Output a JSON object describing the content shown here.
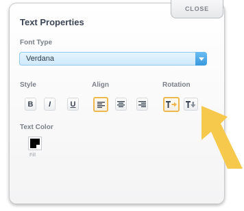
{
  "panel": {
    "title": "Text Properties",
    "close_label": "CLOSE"
  },
  "font": {
    "label": "Font Type",
    "value": "Verdana",
    "arrow_icon": "chevron-down-icon"
  },
  "style": {
    "label": "Style",
    "bold": "B",
    "italic": "I",
    "underline": "U"
  },
  "align": {
    "label": "Align",
    "selected": "left",
    "options": [
      "left",
      "center",
      "right"
    ]
  },
  "rotation": {
    "label": "Rotation",
    "selected": "horizontal",
    "options": [
      "rotate-horizontal",
      "rotate-vertical"
    ]
  },
  "text_color": {
    "label": "Text Color",
    "fill_label": "Fill",
    "value": "#000000"
  },
  "colors": {
    "accent_blue": "#3798dc",
    "selected_outline": "#efb84a",
    "cursor": "#f6c94d"
  }
}
